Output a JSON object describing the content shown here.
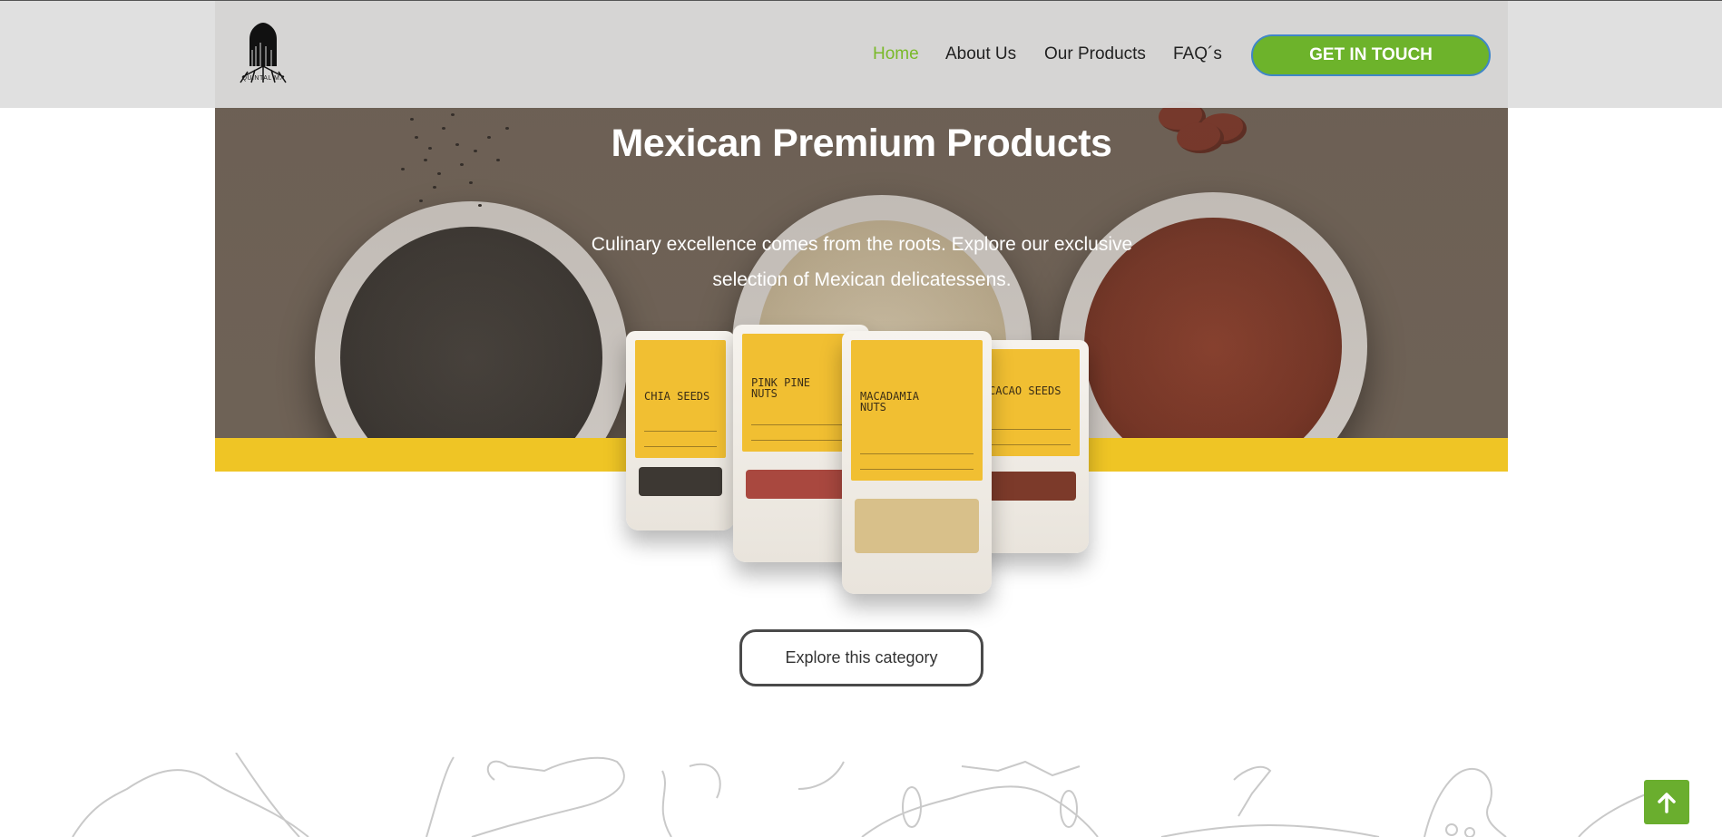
{
  "header": {
    "logo_text": "QUINTAL MX",
    "nav": [
      {
        "label": "Home",
        "active": true
      },
      {
        "label": "About Us"
      },
      {
        "label": "Our Products"
      },
      {
        "label": "FAQ´s"
      }
    ],
    "cta_label": "GET IN TOUCH"
  },
  "hero": {
    "title": "Mexican Premium Products",
    "subtitle": "Culinary excellence comes from the roots. Explore our exclusive selection of Mexican delicatessens."
  },
  "products": [
    {
      "name": "CHIA SEEDS"
    },
    {
      "name": "PINK PINE NUTS"
    },
    {
      "name": "MACADAMIA NUTS"
    },
    {
      "name": "CACAO SEEDS"
    }
  ],
  "explore_label": "Explore this category",
  "colors": {
    "accent_green": "#6db32b",
    "nav_active": "#7ab929",
    "band_yellow": "#efc525",
    "label_yellow": "#f1bf32"
  },
  "icons": {
    "scroll_top": "arrow-up-icon",
    "logo": "tree-logo-icon"
  }
}
